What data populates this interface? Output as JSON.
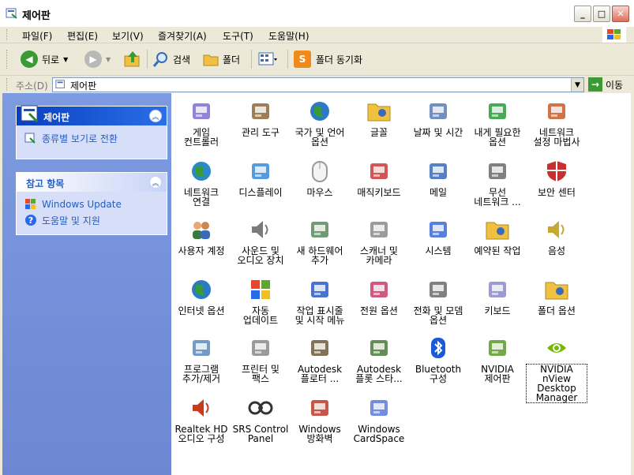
{
  "window": {
    "title": "제어판"
  },
  "menu": [
    "파일(F)",
    "편집(E)",
    "보기(V)",
    "즐겨찾기(A)",
    "도구(T)",
    "도움말(H)"
  ],
  "toolbar": {
    "back": "뒤로",
    "search": "검색",
    "folders": "폴더",
    "sync": "폴더 동기화"
  },
  "address": {
    "label": "주소(D)",
    "value": "제어판",
    "go": "이동"
  },
  "taskpane": {
    "cp_title": "제어판",
    "cp_link": "종류별 보기로 전환",
    "see_also_title": "참고 항목",
    "see_also_links": [
      "Windows Update",
      "도움말 및 지원"
    ]
  },
  "items": [
    {
      "label": "게임\n컨트롤러",
      "icon": "gamepad-icon",
      "color": "#7b6fd0"
    },
    {
      "label": "관리 도구",
      "icon": "admin-tools-icon",
      "color": "#8a6a3a"
    },
    {
      "label": "국가 및 언어\n옵션",
      "icon": "globe-icon",
      "color": "#2a7ac8"
    },
    {
      "label": "글꼴",
      "icon": "fonts-folder-icon",
      "color": "#e8b830"
    },
    {
      "label": "날짜 및 시간",
      "icon": "clock-icon",
      "color": "#5a7ab8"
    },
    {
      "label": "내게 필요한\n옵션",
      "icon": "accessibility-icon",
      "color": "#2a9a3a"
    },
    {
      "label": "네트워크\n설정 마법사",
      "icon": "home-network-icon",
      "color": "#c85a2a"
    },
    {
      "label": "네트워크\n연결",
      "icon": "network-globe-icon",
      "color": "#2a8ac8"
    },
    {
      "label": "디스플레이",
      "icon": "display-icon",
      "color": "#3a8ad8"
    },
    {
      "label": "마우스",
      "icon": "mouse-icon",
      "color": "#9a9a9a"
    },
    {
      "label": "매직키보드",
      "icon": "magic-keyboard-icon",
      "color": "#c83a3a"
    },
    {
      "label": "메일",
      "icon": "mail-icon",
      "color": "#3a6ab8"
    },
    {
      "label": "무선\n네트워크 ...",
      "icon": "wireless-icon",
      "color": "#6a6a6a"
    },
    {
      "label": "보안 센터",
      "icon": "security-shield-icon",
      "color": "#c83030"
    },
    {
      "label": "사용자 계정",
      "icon": "users-icon",
      "color": "#3a7a3a"
    },
    {
      "label": "사운드 및\n오디오 장치",
      "icon": "speaker-icon",
      "color": "#7a7a7a"
    },
    {
      "label": "새 하드웨어\n추가",
      "icon": "add-hardware-icon",
      "color": "#5a8a5a"
    },
    {
      "label": "스캐너 및\n카메라",
      "icon": "scanner-icon",
      "color": "#8a8a8a"
    },
    {
      "label": "시스템",
      "icon": "system-icon",
      "color": "#3a6ad8"
    },
    {
      "label": "예약된 작업",
      "icon": "scheduled-tasks-icon",
      "color": "#e8b830"
    },
    {
      "label": "음성",
      "icon": "speech-icon",
      "color": "#c8a830"
    },
    {
      "label": "인터넷 옵션",
      "icon": "internet-options-icon",
      "color": "#2a7ac8"
    },
    {
      "label": "자동\n업데이트",
      "icon": "windows-flag-icon",
      "color": "#3a9a3a"
    },
    {
      "label": "작업 표시줄\n및 시작 메뉴",
      "icon": "taskbar-icon",
      "color": "#2a5ac8"
    },
    {
      "label": "전원 옵션",
      "icon": "power-icon",
      "color": "#c83a6a"
    },
    {
      "label": "전화 및 모뎀\n옵션",
      "icon": "phone-modem-icon",
      "color": "#6a6a6a"
    },
    {
      "label": "키보드",
      "icon": "keyboard-icon",
      "color": "#8a8ac8"
    },
    {
      "label": "폴더 옵션",
      "icon": "folder-options-icon",
      "color": "#e8b830"
    },
    {
      "label": "프로그램\n추가/제거",
      "icon": "add-remove-programs-icon",
      "color": "#5a8ab8"
    },
    {
      "label": "프린터 및\n팩스",
      "icon": "printer-icon",
      "color": "#8a8a8a"
    },
    {
      "label": "Autodesk\n플로터 ...",
      "icon": "autodesk-plotter-icon",
      "color": "#6a5a3a"
    },
    {
      "label": "Autodesk\n플롯 스타...",
      "icon": "autodesk-plot-style-icon",
      "color": "#4a7a3a"
    },
    {
      "label": "Bluetooth\n구성",
      "icon": "bluetooth-icon",
      "color": "#1a5ad8"
    },
    {
      "label": "NVIDIA\n제어판",
      "icon": "nvidia-control-panel-icon",
      "color": "#5a9a2a"
    },
    {
      "label": "NVIDIA\nnView\nDesktop\nManager",
      "icon": "nvidia-logo-icon",
      "color": "#76b900"
    },
    {
      "label": "Realtek HD\n오디오 구성",
      "icon": "realtek-speaker-icon",
      "color": "#c83a1a"
    },
    {
      "label": "SRS Control\nPanel",
      "icon": "srs-icon",
      "color": "#333333"
    },
    {
      "label": "Windows\n방화벽",
      "icon": "firewall-icon",
      "color": "#b83a2a"
    },
    {
      "label": "Windows\nCardSpace",
      "icon": "cardspace-icon",
      "color": "#5a7ad8"
    }
  ]
}
